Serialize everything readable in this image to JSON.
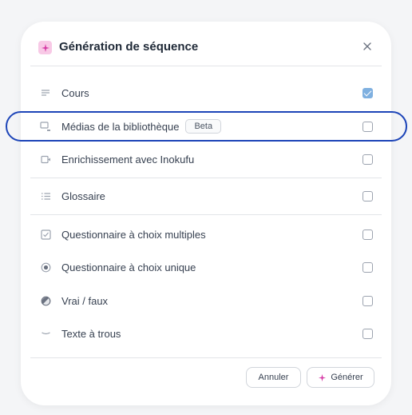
{
  "dialog": {
    "title": "Génération de séquence",
    "close_label": "×"
  },
  "items": [
    {
      "label": "Cours",
      "icon": "lines-icon",
      "checked": true
    },
    {
      "label": "Médias de la bibliothèque",
      "badge": "Beta",
      "icon": "media-icon",
      "checked": false
    },
    {
      "label": "Enrichissement avec Inokufu",
      "icon": "enrich-icon",
      "checked": false
    },
    {
      "label": "Glossaire",
      "icon": "list-icon",
      "checked": false
    },
    {
      "label": "Questionnaire à choix multiples",
      "icon": "checkbox-list-icon",
      "checked": false
    },
    {
      "label": "Questionnaire à choix unique",
      "icon": "radio-icon",
      "checked": false
    },
    {
      "label": "Vrai / faux",
      "icon": "half-circle-icon",
      "checked": false
    },
    {
      "label": "Texte à trous",
      "icon": "blank-icon",
      "checked": false
    }
  ],
  "footer": {
    "cancel_label": "Annuler",
    "generate_label": "Générer"
  },
  "colors": {
    "accent": "#1d45b8",
    "checked": "#7fb0e0",
    "logo_bg": "#f8c9e6",
    "logo_fg": "#d63aa5"
  }
}
